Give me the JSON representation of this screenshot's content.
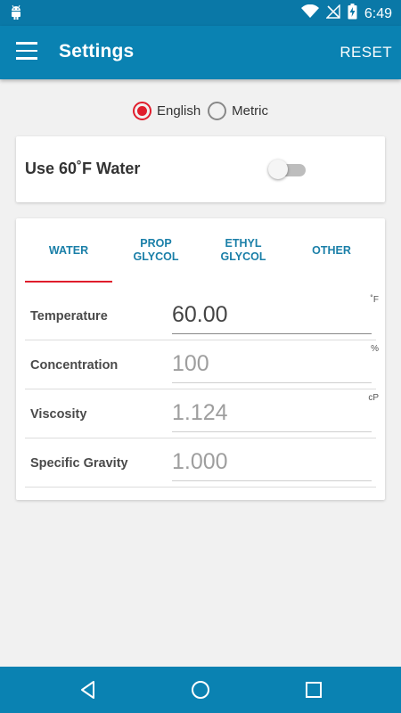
{
  "status_bar": {
    "time": "6:49",
    "icons": [
      "android-icon",
      "wifi-icon",
      "no-signal-icon",
      "battery-charging-icon"
    ]
  },
  "app_bar": {
    "title": "Settings",
    "reset_label": "RESET",
    "menu_icon": "hamburger-menu-icon"
  },
  "units": {
    "options": [
      {
        "label": "English",
        "selected": true
      },
      {
        "label": "Metric",
        "selected": false
      }
    ]
  },
  "water_toggle": {
    "label": "Use 60˚F Water",
    "enabled": false
  },
  "tabs": [
    {
      "label": "WATER",
      "active": true
    },
    {
      "label": "PROP\nGLYCOL",
      "active": false
    },
    {
      "label": "ETHYL\nGLYCOL",
      "active": false
    },
    {
      "label": "OTHER",
      "active": false
    }
  ],
  "fields": [
    {
      "name": "Temperature",
      "value": "60.00",
      "unit": "˚F",
      "editable": true
    },
    {
      "name": "Concentration",
      "value": "100",
      "unit": "%",
      "editable": false
    },
    {
      "name": "Viscosity",
      "value": "1.124",
      "unit": "cP",
      "editable": false
    },
    {
      "name": "Specific Gravity",
      "value": "1.000",
      "unit": "",
      "editable": false
    }
  ],
  "colors": {
    "primary": "#0a82b2",
    "accent": "#e01d2c",
    "tab_text": "#1a7fa8"
  },
  "nav_bar": {
    "icons": [
      "back-icon",
      "home-icon",
      "recents-icon"
    ]
  }
}
